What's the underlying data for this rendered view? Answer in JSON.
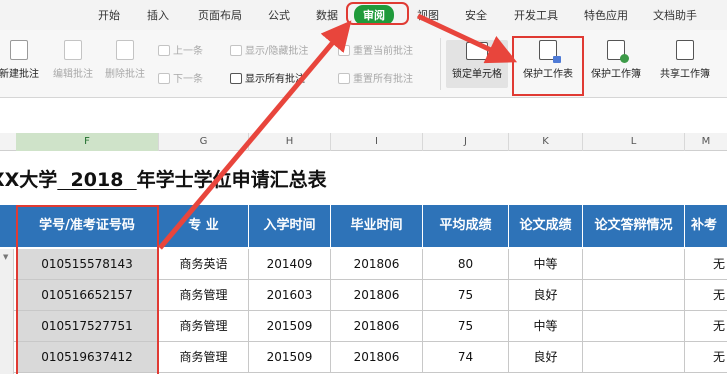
{
  "ribbon": {
    "tabs": [
      {
        "label": "开始"
      },
      {
        "label": "插入"
      },
      {
        "label": "页面布局"
      },
      {
        "label": "公式"
      },
      {
        "label": "数据"
      },
      {
        "label": "审阅",
        "active": true
      },
      {
        "label": "视图"
      },
      {
        "label": "安全"
      },
      {
        "label": "开发工具"
      },
      {
        "label": "特色应用"
      },
      {
        "label": "文档助手"
      }
    ]
  },
  "toolbar": {
    "new_comment": "新建批注",
    "edit_comment": "编辑批注",
    "delete_comment": "删除批注",
    "prev": "上一条",
    "next": "下一条",
    "show_hide_comment": "显示/隐藏批注",
    "show_all_comments": "显示所有批注",
    "reset_current": "重置当前批注",
    "reset_all": "重置所有批注",
    "lock_cell": "锁定单元格",
    "protect_sheet": "保护工作表",
    "protect_workbook": "保护工作簿",
    "share_workbook": "共享工作簿"
  },
  "columns": [
    "F",
    "G",
    "H",
    "I",
    "J",
    "K",
    "L",
    "M"
  ],
  "sheet": {
    "title_prefix": "XX大学",
    "title_year": "2018",
    "title_suffix": "年学士学位申请汇总表"
  },
  "table": {
    "headers": [
      "学号/准考证号码",
      "专 业",
      "入学时间",
      "毕业时间",
      "平均成绩",
      "论文成绩",
      "论文答辩情况",
      "补考"
    ],
    "rows": [
      [
        "010515578143",
        "商务英语",
        "201409",
        "201806",
        "80",
        "中等",
        "",
        "无"
      ],
      [
        "010516652157",
        "商务管理",
        "201603",
        "201806",
        "75",
        "良好",
        "",
        "无"
      ],
      [
        "010517527751",
        "商务管理",
        "201509",
        "201806",
        "75",
        "中等",
        "",
        "无"
      ],
      [
        "010519637412",
        "商务管理",
        "201509",
        "201806",
        "74",
        "良好",
        "",
        "无"
      ]
    ]
  },
  "colors": {
    "accent_green": "#1f9a3a",
    "header_blue": "#2e73b8",
    "annotation_red": "#e03a33"
  }
}
